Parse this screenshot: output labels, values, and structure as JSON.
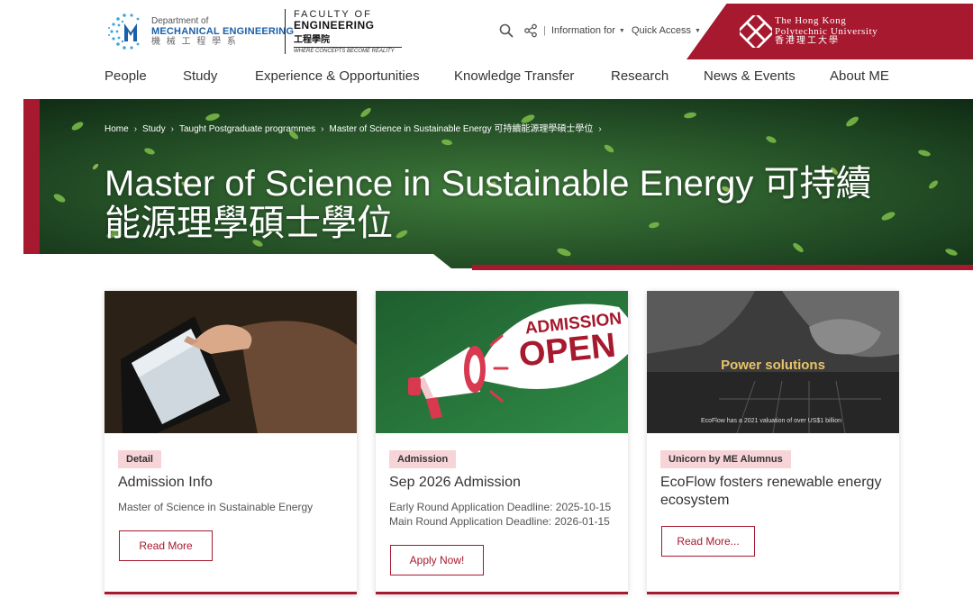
{
  "colors": {
    "brand_red": "#a6192e",
    "tag_bg": "#f6d4d8",
    "dept_blue": "#1b5fa8",
    "hero_green": "#2c5a2c"
  },
  "header": {
    "dept_logo": {
      "line1": "Department of",
      "line2": "MECHANICAL ENGINEERING",
      "line3": "機 械 工 程 學 系",
      "icon": "dept-me-logo"
    },
    "faculty_logo": {
      "line1": "FACULTY OF",
      "line2": "ENGINEERING",
      "line3": "工程學院",
      "line4": "WHERE CONCEPTS BECOME REALITY"
    },
    "utility": {
      "search_icon": "search-icon",
      "share_icon": "share-icon",
      "separator": "|",
      "info_label": "Information for",
      "quick_label": "Quick Access"
    },
    "university_logo": {
      "line1": "The Hong Kong",
      "line2": "Polytechnic University",
      "line3": "香港理工大學"
    }
  },
  "nav": {
    "items": [
      "People",
      "Study",
      "Experience & Opportunities",
      "Knowledge Transfer",
      "Research",
      "News & Events",
      "About ME"
    ]
  },
  "hero": {
    "breadcrumb": [
      "Home",
      "Study",
      "Taught Postgraduate programmes",
      "Master of Science in Sustainable Energy 可持續能源理學碩士學位"
    ],
    "title": "Master of Science in Sustainable Energy 可持續能源理學碩士學位"
  },
  "cards": [
    {
      "tag": "Detail",
      "title": "Admission Info",
      "sub": "Master of Science in Sustainable Energy",
      "button": "Read More"
    },
    {
      "tag": "Admission",
      "title": "Sep 2026 Admission",
      "sub_line1": "Early Round Application Deadline: 2025-10-15",
      "sub_line2": "Main Round Application Deadline: 2026-01-15",
      "button": "Apply Now!",
      "image_text_1": "ADMISSION",
      "image_text_2": "OPEN"
    },
    {
      "tag": "Unicorn by ME Alumnus",
      "title": "EcoFlow fosters renewable energy ecosystem",
      "button": "Read More...",
      "image_text_1": "Power solutions",
      "image_caption": "EcoFlow has a 2021 valuation of over US$1 billion"
    }
  ]
}
